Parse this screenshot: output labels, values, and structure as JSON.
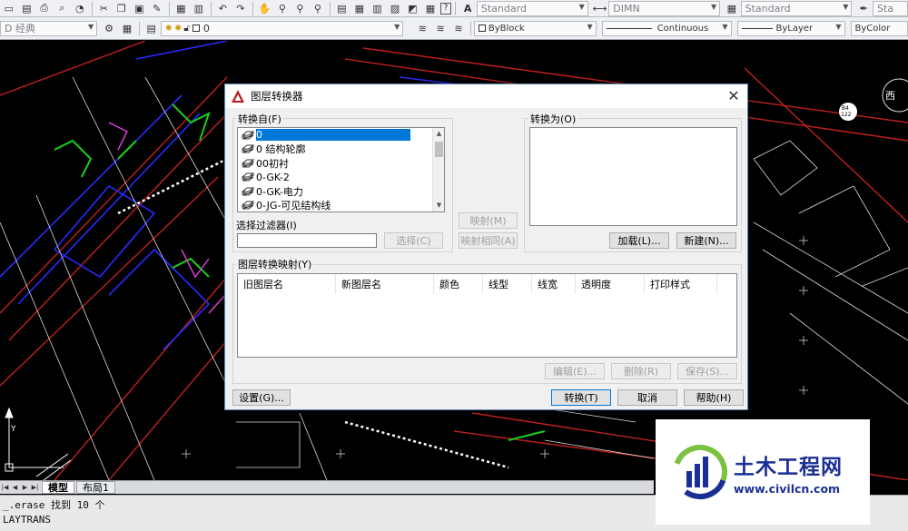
{
  "toolbar": {
    "text_style": "Standard",
    "dim_style": "DIMN",
    "table_style": "Standard",
    "multileader_style": "Sta"
  },
  "layerbar": {
    "workspace": "D 经典",
    "layer": "0",
    "color": "ByBlock",
    "linetype": "Continuous",
    "lineweight": "ByLayer",
    "plotstyle": "ByColor"
  },
  "canvas": {
    "compass_label": "西",
    "marker_label": "B4\n122"
  },
  "dialog": {
    "title": "图层转换器",
    "convert_from_label": "转换自(F)",
    "convert_to_label": "转换为(O)",
    "from_layers": [
      "0",
      "0 结构轮廓",
      "00初衬",
      "0-GK-2",
      "0-GK-电力",
      "0-JG-可见结构线"
    ],
    "selected_index": 0,
    "filter_label": "选择过滤器(I)",
    "filter_value": "",
    "select_button": "选择(C)",
    "map_button": "映射(M)",
    "map_same_button": "映射相同(A)",
    "load_button": "加载(L)...",
    "new_button": "新建(N)...",
    "mappings_label": "图层转换映射(Y)",
    "columns": [
      "旧图层名",
      "新图层名",
      "颜色",
      "线型",
      "线宽",
      "透明度",
      "打印样式"
    ],
    "edit_button": "编辑(E)...",
    "remove_button": "删除(R)",
    "save_button": "保存(S)...",
    "settings_button": "设置(G)...",
    "translate_button": "转换(T)",
    "cancel_button": "取消",
    "help_button": "帮助(H)"
  },
  "tabs": [
    "模型",
    "布局1"
  ],
  "cmdline": {
    "line1": "_.erase 找到 10 个",
    "line2": "LAYTRANS"
  },
  "watermark": {
    "title": "土木工程网",
    "url": "www.civilcn.com"
  },
  "colors": {
    "accent": "#0078d7",
    "cad_bg": "#000000",
    "watermark_blue": "#1a2f93",
    "watermark_green": "#7cc242"
  }
}
